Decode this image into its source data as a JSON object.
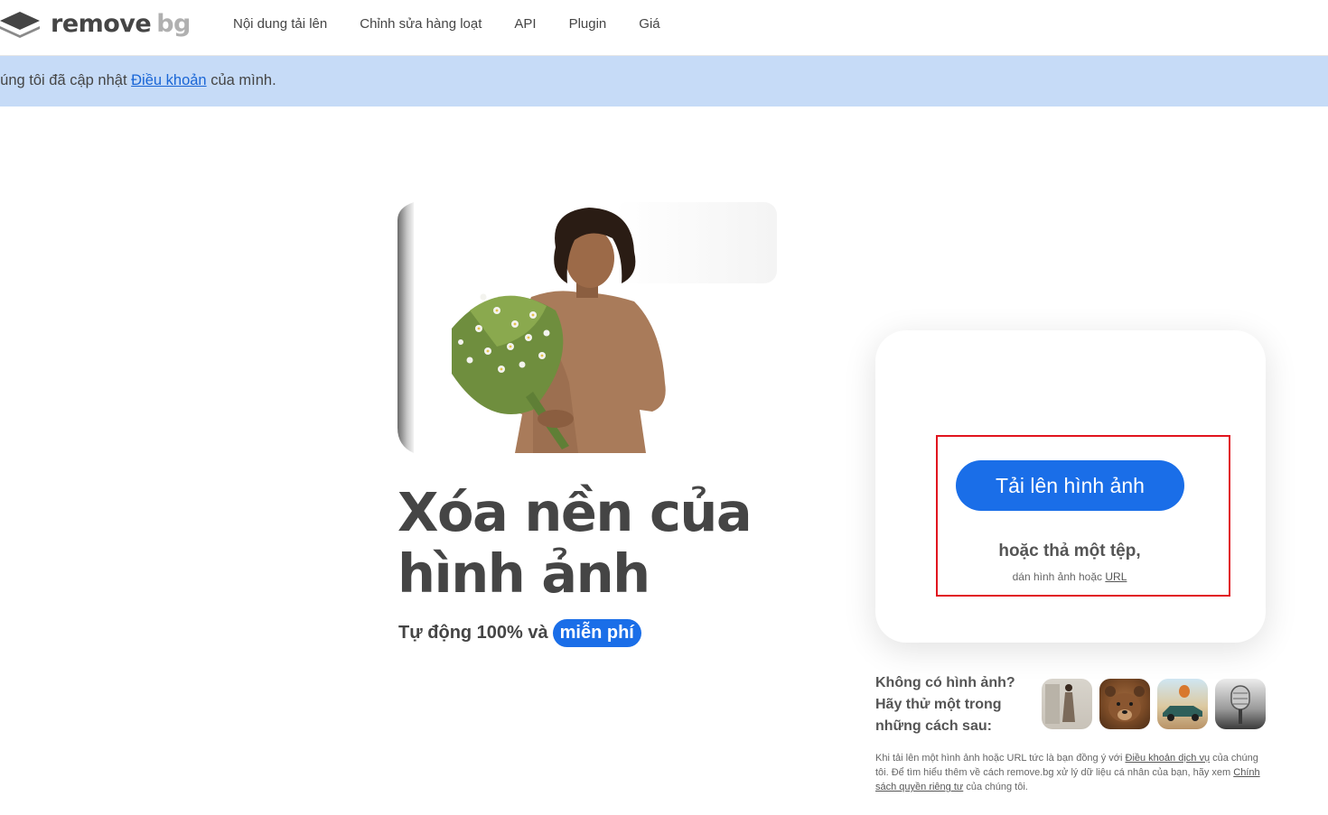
{
  "header": {
    "logo_main": "remove",
    "logo_accent": "bg",
    "nav": [
      "Nội dung tải lên",
      "Chỉnh sửa hàng loạt",
      "API",
      "Plugin",
      "Giá"
    ]
  },
  "banner": {
    "prefix": "húng tôi đã cập nhật ",
    "link": "Điều khoản",
    "suffix": " của mình."
  },
  "hero": {
    "title": "Xóa nền của hình ảnh",
    "subtitle": "Tự động 100% và",
    "free_badge": "miễn phí"
  },
  "upload": {
    "button_label": "Tải lên hình ảnh",
    "drop_text": "hoặc thả một tệp,",
    "paste_prefix": "dán hình ảnh hoặc ",
    "paste_link": "URL"
  },
  "samples": {
    "prompt": "Không có hình ảnh? Hãy thử một trong những cách sau:",
    "items": [
      "woman-photo",
      "bear-photo",
      "car-photo",
      "microphone-photo"
    ]
  },
  "legal": {
    "t1": "Khi tải lên một hình ảnh hoặc URL tức là bạn đồng ý với ",
    "link1": "Điều khoản dịch vụ",
    "t2": " của chúng tôi. Để tìm hiểu thêm về cách remove.bg xử lý dữ liệu cá nhân của bạn, hãy xem ",
    "link2": "Chính sách quyền riêng tư",
    "t3": " của chúng tôi."
  },
  "colors": {
    "accent": "#1a6ee8",
    "banner": "#c6dbf7",
    "highlight": "#e1141e",
    "text": "#454545"
  }
}
